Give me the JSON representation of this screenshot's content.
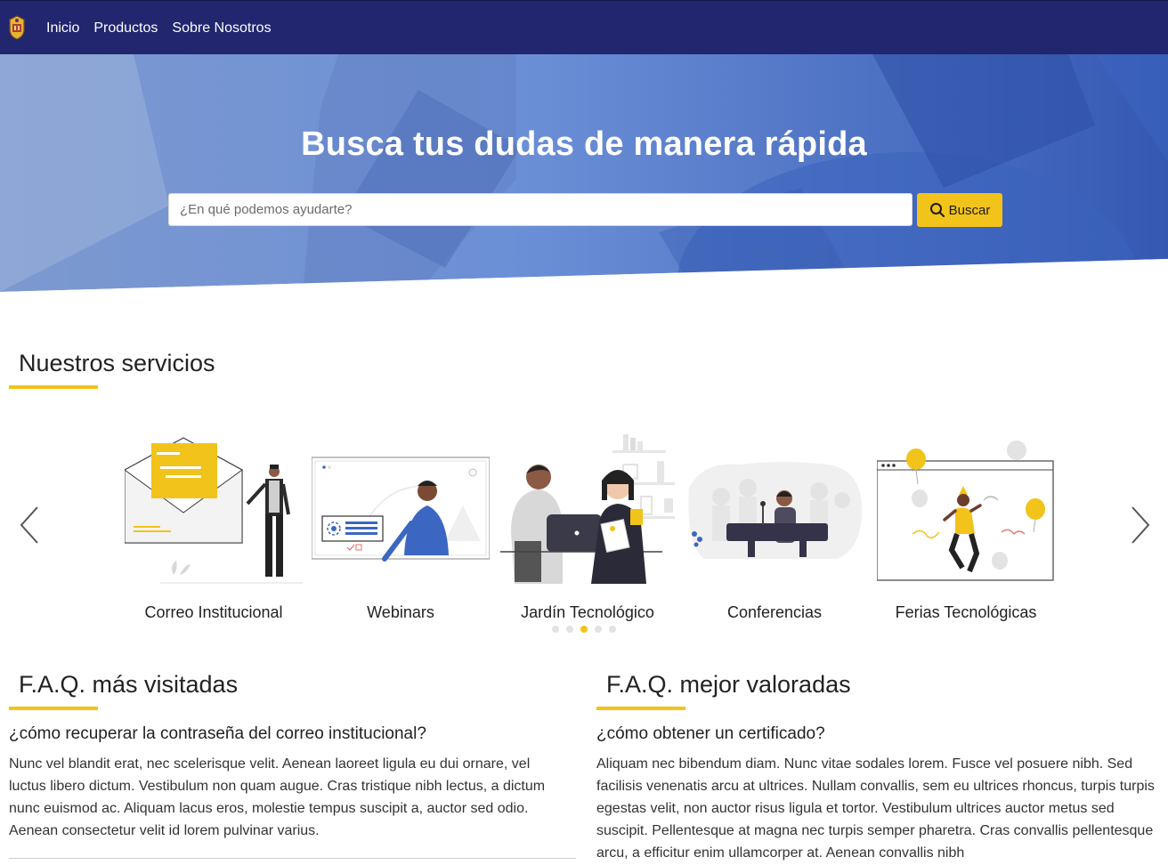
{
  "nav": {
    "logo_icon": "university-crest-icon",
    "links": [
      "Inicio",
      "Productos",
      "Sobre Nosotros"
    ]
  },
  "hero": {
    "title": "Busca tus dudas de manera rápida",
    "search_placeholder": "¿En qué podemos ayudarte?",
    "search_button": "Buscar",
    "search_icon": "search-icon"
  },
  "services": {
    "title": "Nuestros servicios",
    "items": [
      {
        "label": "Correo Institucional",
        "icon": "envelope-illustration"
      },
      {
        "label": "Webinars",
        "icon": "webinar-illustration"
      },
      {
        "label": "Jardín Tecnológico",
        "icon": "laptop-people-illustration"
      },
      {
        "label": "Conferencias",
        "icon": "conference-illustration"
      },
      {
        "label": "Ferias Tecnológicas",
        "icon": "party-celebration-illustration"
      }
    ],
    "prev_icon": "chevron-left-icon",
    "next_icon": "chevron-right-icon",
    "dots_count": 5,
    "active_dot": 3
  },
  "faq_visited": {
    "title": "F.A.Q. más visitadas",
    "question": "¿cómo recuperar la contraseña del correo institucional?",
    "answer": "Nunc vel blandit erat, nec scelerisque velit. Aenean laoreet ligula eu dui ornare, vel luctus libero dictum. Vestibulum non quam augue. Cras tristique nibh lectus, a dictum nunc euismod ac. Aliquam lacus eros, molestie tempus suscipit a, auctor sed odio. Aenean consectetur velit id lorem pulvinar varius."
  },
  "faq_rated": {
    "title": "F.A.Q. mejor valoradas",
    "question": "¿cómo obtener un certificado?",
    "answer": "Aliquam nec bibendum diam. Nunc vitae sodales lorem. Fusce vel posuere nibh. Sed facilisis venenatis arcu at ultrices. Nullam convallis, sem eu ultrices rhoncus, turpis turpis egestas velit, non auctor risus ligula et tortor. Vestibulum ultrices auctor metus sed suscipit. Pellentesque at magna nec turpis semper pharetra. Cras convallis pellentesque arcu, a efficitur enim ullamcorper at. Aenean convallis nibh"
  },
  "colors": {
    "nav_bg": "#22266e",
    "accent": "#f2c31a",
    "hero_blue": "#4a74c9"
  }
}
